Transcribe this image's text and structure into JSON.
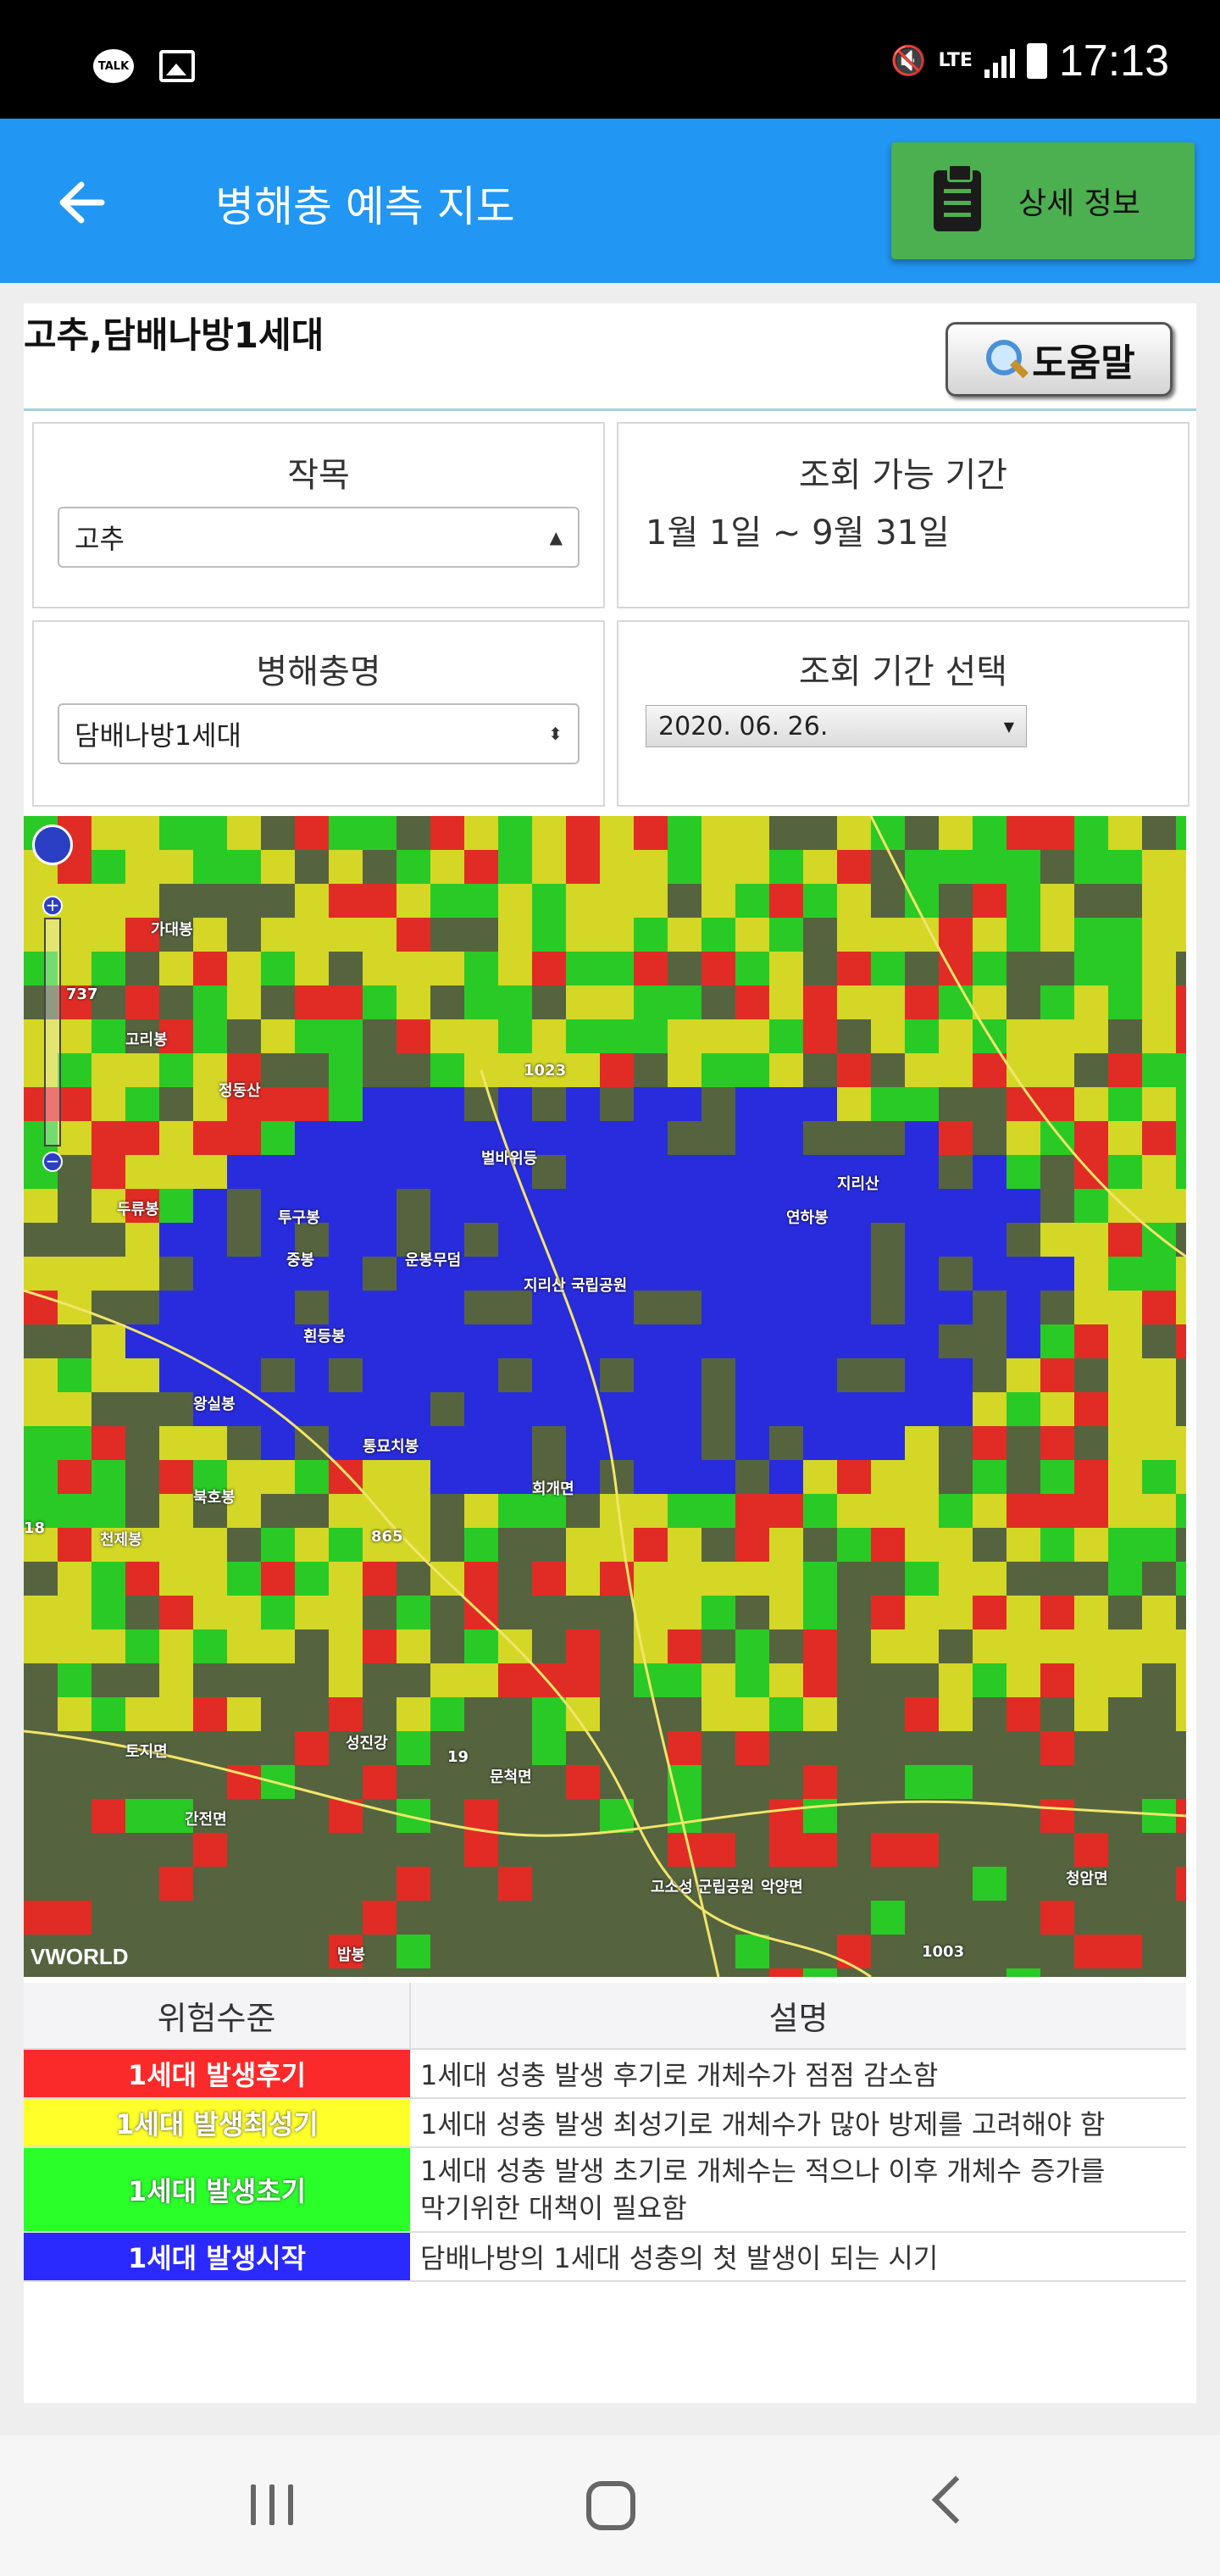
{
  "status_bar": {
    "time": "17:13",
    "network": "LTE",
    "talk_icon_text": "TALK"
  },
  "app_bar": {
    "title": "병해충 예측 지도",
    "detail_button": "상세 정보"
  },
  "page": {
    "heading": "고추,담배나방1세대",
    "help_button": "도움말"
  },
  "form": {
    "crop_label": "작목",
    "crop_value": "고추",
    "period_label": "조회 가능 기간",
    "period_value": "1월 1일 ~ 9월 31일",
    "pest_label": "병해충명",
    "pest_value": "담배나방1세대",
    "date_label": "조회 기간 선택",
    "date_value": "2020. 06. 26."
  },
  "map": {
    "attribution": "VWORLD",
    "place_labels": [
      "가대봉",
      "고리봉",
      "정동산",
      "1023",
      "벌바위등",
      "지리산",
      "연하봉",
      "두류봉",
      "투구봉",
      "중봉",
      "운봉무덤",
      "지리산 국립공원",
      "왕실봉",
      "흰등봉",
      "통묘치봉",
      "북호봉",
      "회개면",
      "천제봉",
      "865",
      "18",
      "19",
      "토지면",
      "성진강",
      "문척면",
      "간전면",
      "고소성 군립공원",
      "악양면",
      "1003",
      "밥봉",
      "청암면",
      "737"
    ],
    "colors": {
      "red": "#ff2020",
      "yellow": "#f0f020",
      "green": "#20e020",
      "blue": "#2020ff"
    }
  },
  "legend": {
    "header_level": "위험수준",
    "header_desc": "설명",
    "rows": [
      {
        "level": "1세대 발생후기",
        "desc": "1세대 성충 발생 후기로 개체수가 점점 감소함",
        "color": "#fb2a2a"
      },
      {
        "level": "1세대 발생최성기",
        "desc": "1세대 성충 발생 최성기로 개체수가 많아 방제를 고려해야 함",
        "color": "#ffff2a"
      },
      {
        "level": "1세대 발생초기",
        "desc": "1세대 성충 발생 초기로 개체수는 적으나 이후 개체수 증가를 막기위한 대책이 필요함",
        "color": "#2aff2a"
      },
      {
        "level": "1세대 발생시작",
        "desc": "담배나방의 1세대 성충의 첫 발생이 되는 시기",
        "color": "#2a2aff"
      }
    ]
  }
}
